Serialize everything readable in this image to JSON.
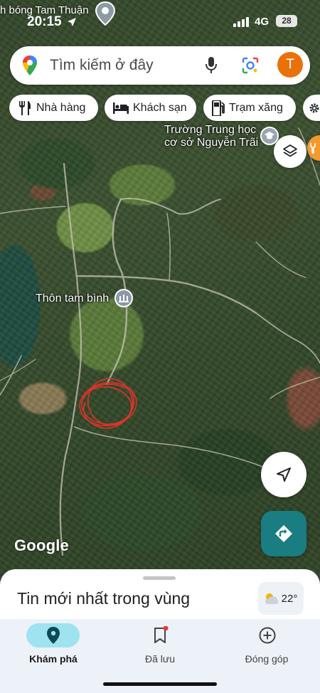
{
  "status_bar": {
    "time": "20:15",
    "network": "4G",
    "battery": "28",
    "nearby_place": "h bóng Tam Thuận"
  },
  "search": {
    "placeholder": "Tìm kiếm ở đây",
    "avatar_letter": "T"
  },
  "chips": [
    {
      "label": "Nhà hàng",
      "icon": "restaurant-icon"
    },
    {
      "label": "Khách sạn",
      "icon": "bed-icon"
    },
    {
      "label": "Trạm xăng",
      "icon": "gas-station-icon"
    }
  ],
  "map": {
    "labels": [
      {
        "text": "Trường Trung học cơ sở Nguyễn Trãi",
        "icon": "school-icon"
      },
      {
        "text": "Thôn tam bình",
        "icon": "landmark-icon"
      }
    ],
    "top_label_fragment": "u",
    "attribution": "Google",
    "annotation": "red-scribble-circle"
  },
  "sheet": {
    "title": "Tin mới nhất trong vùng",
    "temperature": "22°"
  },
  "nav": [
    {
      "label": "Khám phá",
      "icon": "location-pin-icon",
      "active": true
    },
    {
      "label": "Đã lưu",
      "icon": "bookmark-icon",
      "active": false,
      "badge": true
    },
    {
      "label": "Đóng góp",
      "icon": "add-circle-icon",
      "active": false
    }
  ],
  "colors": {
    "accent_teal": "#1a7d82",
    "avatar_orange": "#e8710a",
    "nav_active_pill": "#9fe3f0",
    "annotation_red": "#e8322a"
  }
}
